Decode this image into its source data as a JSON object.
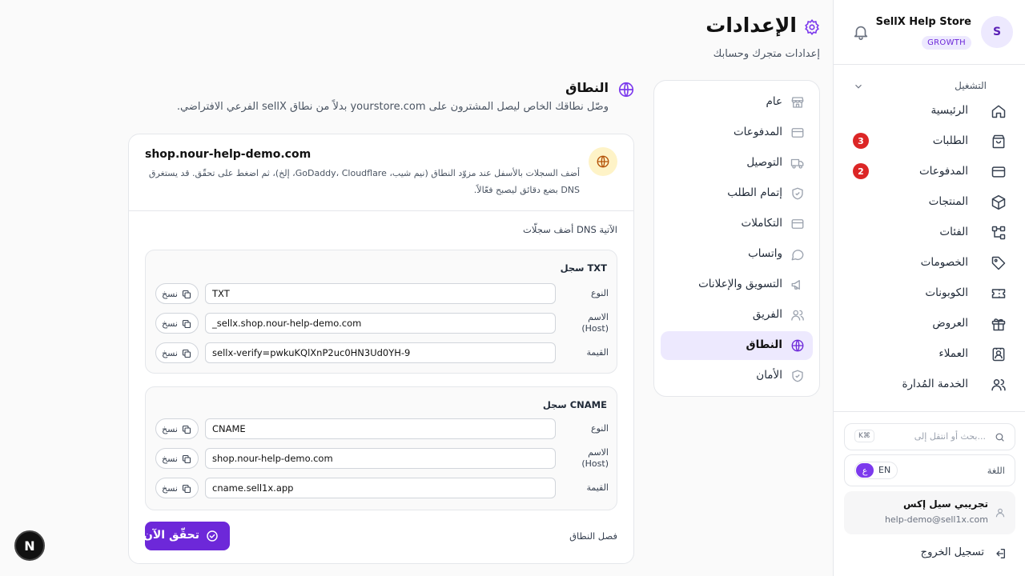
{
  "store": {
    "avatar_letter": "S",
    "name": "SellX Help Store",
    "plan": "GROWTH"
  },
  "sidebar": {
    "section_label": "التشغيل",
    "items": [
      {
        "label": "الرئيسية",
        "icon": "home-icon"
      },
      {
        "label": "الطلبات",
        "icon": "shopping-bag-icon",
        "badge": "3"
      },
      {
        "label": "المدفوعات",
        "icon": "credit-card-icon",
        "badge": "2"
      },
      {
        "label": "المنتجات",
        "icon": "package-icon"
      },
      {
        "label": "الفئات",
        "icon": "hierarchy-icon"
      },
      {
        "label": "الخصومات",
        "icon": "tag-icon"
      },
      {
        "label": "الكوبونات",
        "icon": "ticket-icon"
      },
      {
        "label": "العروض",
        "icon": "gift-icon"
      },
      {
        "label": "العملاء",
        "icon": "contact-card-icon"
      },
      {
        "label": "الخدمة المُدارة",
        "icon": "users-icon"
      }
    ],
    "search_placeholder": "بحث أو انتقل إلى...",
    "search_shortcut": "K⌘",
    "language_label": "اللغة",
    "lang_options": {
      "ar": "ع",
      "en": "EN"
    },
    "user": {
      "name": "تجريبي سيل إكس",
      "email": "help-demo@sell1x.com"
    },
    "logout_label": "تسجيل الخروج"
  },
  "header": {
    "title": "الإعدادات",
    "subtitle": "إعدادات متجرك وحسابك"
  },
  "settings_nav": [
    {
      "label": "عام",
      "icon": "store-icon"
    },
    {
      "label": "المدفوعات",
      "icon": "credit-card-icon"
    },
    {
      "label": "التوصيل",
      "icon": "truck-icon"
    },
    {
      "label": "إتمام الطلب",
      "icon": "shield-check-icon"
    },
    {
      "label": "التكاملات",
      "icon": "credit-card-icon"
    },
    {
      "label": "واتساب",
      "icon": "message-circle-icon"
    },
    {
      "label": "التسويق والإعلانات",
      "icon": "megaphone-icon"
    },
    {
      "label": "الفريق",
      "icon": "users-icon"
    },
    {
      "label": "النطاق",
      "icon": "globe-icon",
      "active": true
    },
    {
      "label": "الأمان",
      "icon": "shield-check-icon"
    }
  ],
  "domain_section": {
    "title": "النطاق",
    "description": "وصّل نطاقك الخاص ليصل المشترون على yourstore.com بدلاً من نطاق sellX الفرعي الافتراضي.",
    "domain": "shop.nour-help-demo.com",
    "instructions": "أضف السجلات بالأسفل عند مزوّد النطاق (نيم شيب، GoDaddy، Cloudflare، إلخ)، ثم اضغط على تحقّق. قد يستغرق DNS بضع دقائق ليصبح فعّالاً.",
    "dns_heading": "أضف سجلّات DNS الآتية",
    "copy_label": "نسخ",
    "labels": {
      "type": "النوع",
      "name": "الاسم",
      "host": "(Host)",
      "value": "القيمة"
    },
    "records": [
      {
        "title": "سجل TXT",
        "type": "TXT",
        "name": "_sellx.shop.nour-help-demo.com",
        "value": "sellx-verify=pwkuKQlXnP2uc0HN3Ud0YH-9"
      },
      {
        "title": "سجل CNAME",
        "type": "CNAME",
        "name": "shop.nour-help-demo.com",
        "value": "cname.sell1x.app"
      }
    ],
    "disconnect_label": "فصل النطاق",
    "verify_label": "تحقّق الآن"
  },
  "dev_badge": "N",
  "colors": {
    "accent": "#6d28d9",
    "accent_light": "#ede9fe",
    "badge_red": "#dc2626",
    "globe_bg": "#fef3c7"
  }
}
